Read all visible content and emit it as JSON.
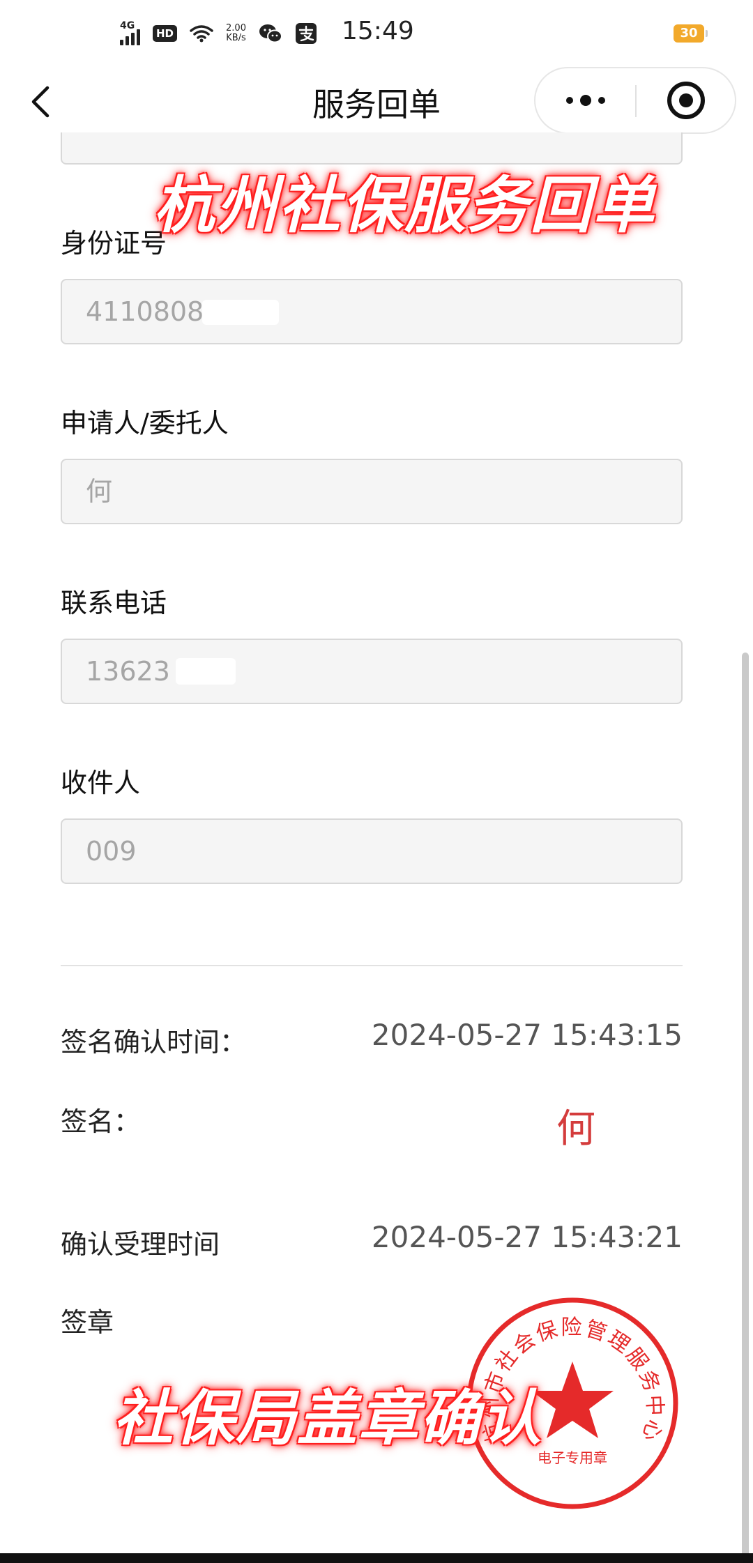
{
  "status_bar": {
    "network": "4G",
    "hd": "HD",
    "speed_value": "2.00",
    "speed_unit": "KB/s",
    "time": "15:49",
    "battery": "30"
  },
  "nav": {
    "title": "服务回单",
    "back_icon": "chevron-left-icon",
    "more_icon": "more-dots-icon",
    "close_icon": "target-circle-icon"
  },
  "overlay": {
    "title": "杭州社保服务回单",
    "caption": "社保局盖章确认"
  },
  "form": {
    "fields": [
      {
        "label": "身份证号",
        "value": "4110808"
      },
      {
        "label": "申请人/委托人",
        "value": "何"
      },
      {
        "label": "联系电话",
        "value": "13623"
      },
      {
        "label": "收件人",
        "value": "009"
      }
    ]
  },
  "receipt": {
    "sign_confirm_label": "签名确认时间：",
    "sign_confirm_time": "2024-05-27 15:43:15",
    "signature_label": "签名：",
    "signature_value": "何",
    "accept_label": "确认受理时间",
    "accept_time": "2024-05-27 15:43:21",
    "seal_label": "签章"
  },
  "stamp": {
    "ring_text": "杭州市社会保险管理服务中心",
    "inner_text": "电子专用章",
    "color": "#e52a2a"
  },
  "colors": {
    "overlay_glow": "#ff2020",
    "signature": "#d43c3c",
    "battery": "#f2a92b"
  }
}
